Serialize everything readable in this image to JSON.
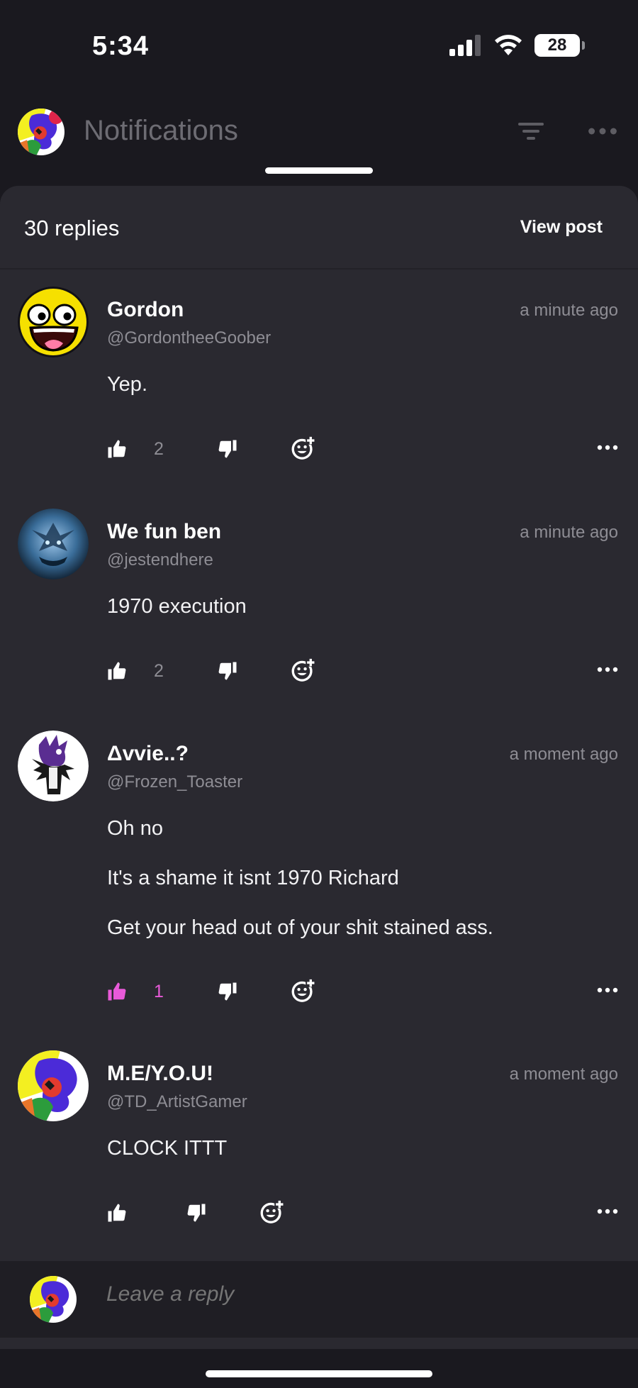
{
  "status_bar": {
    "time": "5:34",
    "battery": "28"
  },
  "header": {
    "title": "Notifications"
  },
  "sheet": {
    "replies_count": "30 replies",
    "view_post_label": "View post"
  },
  "replies": [
    {
      "name": "Gordon",
      "handle": "@GordontheeGoober",
      "time": "a minute ago",
      "lines": [
        "Yep."
      ],
      "likes": "2"
    },
    {
      "name": "We fun ben",
      "handle": "@jestendhere",
      "time": "a minute ago",
      "lines": [
        "1970 execution"
      ],
      "likes": "2"
    },
    {
      "name": "Δvvie..?",
      "handle": "@Frozen_Toaster",
      "time": "a moment ago",
      "lines": [
        "Oh no",
        "It's a shame it isnt 1970 Richard",
        "Get your head out of your shit stained ass."
      ],
      "likes": "1"
    },
    {
      "name": "M.E/Y.O.U!",
      "handle": "@TD_ArtistGamer",
      "time": "a moment ago",
      "lines": [
        "CLOCK ITTT"
      ]
    }
  ],
  "reply_bar": {
    "placeholder": "Leave a reply"
  },
  "colors": {
    "background": "#1a191f",
    "sheet": "#2a2930",
    "accent_liked": "#e95ad9",
    "muted_text": "#8e8d94"
  }
}
